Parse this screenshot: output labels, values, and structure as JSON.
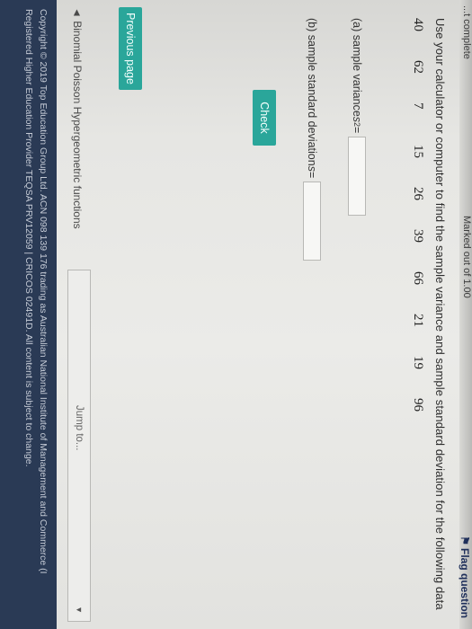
{
  "header": {
    "left_fragment": "...t complete",
    "marks_text": "Marked out of 1.00",
    "flag_label": "Flag question"
  },
  "question": {
    "prompt": "Use your calculator or computer to find the sample variance and sample standard deviation for the following data",
    "data_values": [
      "40",
      "62",
      "7",
      "15",
      "26",
      "39",
      "66",
      "21",
      "19",
      "96"
    ],
    "part_a": {
      "label_prefix": "(a) sample variance ",
      "symbol": "s",
      "exponent": "2",
      "equals": "=",
      "value": ""
    },
    "part_b": {
      "label_prefix": "(b) sample standard deviation ",
      "symbol": "s",
      "equals": "=",
      "value": ""
    }
  },
  "actions": {
    "check_label": "Check",
    "previous_page_label": "Previous page"
  },
  "navigation": {
    "prev_activity_label": "◄ Binomial Poisson Hypergeometric functions",
    "jump_to_placeholder": "Jump to..."
  },
  "footer": {
    "line1": "Copyright © 2019 Top Education Group Ltd. ACN 098 139 176 trading as Australian National Institute of Management and Commerce (I",
    "line2": "Registered Higher Education Provider TEQSA PRV12059 | CRICOS 02491D. All content is subject to change."
  },
  "colors": {
    "accent": "#2aa69a",
    "footer_bg": "#2a3a55"
  }
}
